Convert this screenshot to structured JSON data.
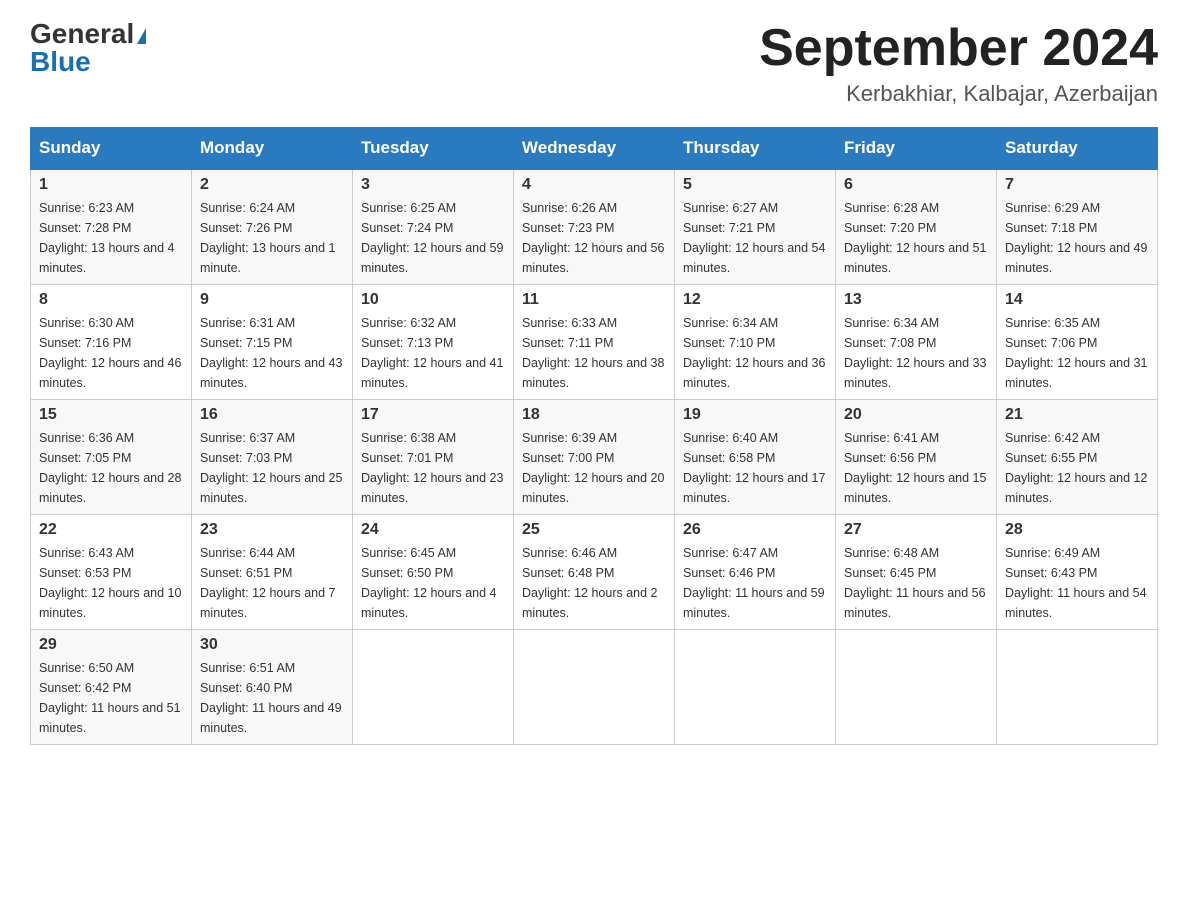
{
  "logo": {
    "general": "General",
    "blue": "Blue"
  },
  "title": {
    "month_year": "September 2024",
    "location": "Kerbakhiar, Kalbajar, Azerbaijan"
  },
  "headers": [
    "Sunday",
    "Monday",
    "Tuesday",
    "Wednesday",
    "Thursday",
    "Friday",
    "Saturday"
  ],
  "weeks": [
    [
      {
        "day": "1",
        "sunrise": "Sunrise: 6:23 AM",
        "sunset": "Sunset: 7:28 PM",
        "daylight": "Daylight: 13 hours and 4 minutes."
      },
      {
        "day": "2",
        "sunrise": "Sunrise: 6:24 AM",
        "sunset": "Sunset: 7:26 PM",
        "daylight": "Daylight: 13 hours and 1 minute."
      },
      {
        "day": "3",
        "sunrise": "Sunrise: 6:25 AM",
        "sunset": "Sunset: 7:24 PM",
        "daylight": "Daylight: 12 hours and 59 minutes."
      },
      {
        "day": "4",
        "sunrise": "Sunrise: 6:26 AM",
        "sunset": "Sunset: 7:23 PM",
        "daylight": "Daylight: 12 hours and 56 minutes."
      },
      {
        "day": "5",
        "sunrise": "Sunrise: 6:27 AM",
        "sunset": "Sunset: 7:21 PM",
        "daylight": "Daylight: 12 hours and 54 minutes."
      },
      {
        "day": "6",
        "sunrise": "Sunrise: 6:28 AM",
        "sunset": "Sunset: 7:20 PM",
        "daylight": "Daylight: 12 hours and 51 minutes."
      },
      {
        "day": "7",
        "sunrise": "Sunrise: 6:29 AM",
        "sunset": "Sunset: 7:18 PM",
        "daylight": "Daylight: 12 hours and 49 minutes."
      }
    ],
    [
      {
        "day": "8",
        "sunrise": "Sunrise: 6:30 AM",
        "sunset": "Sunset: 7:16 PM",
        "daylight": "Daylight: 12 hours and 46 minutes."
      },
      {
        "day": "9",
        "sunrise": "Sunrise: 6:31 AM",
        "sunset": "Sunset: 7:15 PM",
        "daylight": "Daylight: 12 hours and 43 minutes."
      },
      {
        "day": "10",
        "sunrise": "Sunrise: 6:32 AM",
        "sunset": "Sunset: 7:13 PM",
        "daylight": "Daylight: 12 hours and 41 minutes."
      },
      {
        "day": "11",
        "sunrise": "Sunrise: 6:33 AM",
        "sunset": "Sunset: 7:11 PM",
        "daylight": "Daylight: 12 hours and 38 minutes."
      },
      {
        "day": "12",
        "sunrise": "Sunrise: 6:34 AM",
        "sunset": "Sunset: 7:10 PM",
        "daylight": "Daylight: 12 hours and 36 minutes."
      },
      {
        "day": "13",
        "sunrise": "Sunrise: 6:34 AM",
        "sunset": "Sunset: 7:08 PM",
        "daylight": "Daylight: 12 hours and 33 minutes."
      },
      {
        "day": "14",
        "sunrise": "Sunrise: 6:35 AM",
        "sunset": "Sunset: 7:06 PM",
        "daylight": "Daylight: 12 hours and 31 minutes."
      }
    ],
    [
      {
        "day": "15",
        "sunrise": "Sunrise: 6:36 AM",
        "sunset": "Sunset: 7:05 PM",
        "daylight": "Daylight: 12 hours and 28 minutes."
      },
      {
        "day": "16",
        "sunrise": "Sunrise: 6:37 AM",
        "sunset": "Sunset: 7:03 PM",
        "daylight": "Daylight: 12 hours and 25 minutes."
      },
      {
        "day": "17",
        "sunrise": "Sunrise: 6:38 AM",
        "sunset": "Sunset: 7:01 PM",
        "daylight": "Daylight: 12 hours and 23 minutes."
      },
      {
        "day": "18",
        "sunrise": "Sunrise: 6:39 AM",
        "sunset": "Sunset: 7:00 PM",
        "daylight": "Daylight: 12 hours and 20 minutes."
      },
      {
        "day": "19",
        "sunrise": "Sunrise: 6:40 AM",
        "sunset": "Sunset: 6:58 PM",
        "daylight": "Daylight: 12 hours and 17 minutes."
      },
      {
        "day": "20",
        "sunrise": "Sunrise: 6:41 AM",
        "sunset": "Sunset: 6:56 PM",
        "daylight": "Daylight: 12 hours and 15 minutes."
      },
      {
        "day": "21",
        "sunrise": "Sunrise: 6:42 AM",
        "sunset": "Sunset: 6:55 PM",
        "daylight": "Daylight: 12 hours and 12 minutes."
      }
    ],
    [
      {
        "day": "22",
        "sunrise": "Sunrise: 6:43 AM",
        "sunset": "Sunset: 6:53 PM",
        "daylight": "Daylight: 12 hours and 10 minutes."
      },
      {
        "day": "23",
        "sunrise": "Sunrise: 6:44 AM",
        "sunset": "Sunset: 6:51 PM",
        "daylight": "Daylight: 12 hours and 7 minutes."
      },
      {
        "day": "24",
        "sunrise": "Sunrise: 6:45 AM",
        "sunset": "Sunset: 6:50 PM",
        "daylight": "Daylight: 12 hours and 4 minutes."
      },
      {
        "day": "25",
        "sunrise": "Sunrise: 6:46 AM",
        "sunset": "Sunset: 6:48 PM",
        "daylight": "Daylight: 12 hours and 2 minutes."
      },
      {
        "day": "26",
        "sunrise": "Sunrise: 6:47 AM",
        "sunset": "Sunset: 6:46 PM",
        "daylight": "Daylight: 11 hours and 59 minutes."
      },
      {
        "day": "27",
        "sunrise": "Sunrise: 6:48 AM",
        "sunset": "Sunset: 6:45 PM",
        "daylight": "Daylight: 11 hours and 56 minutes."
      },
      {
        "day": "28",
        "sunrise": "Sunrise: 6:49 AM",
        "sunset": "Sunset: 6:43 PM",
        "daylight": "Daylight: 11 hours and 54 minutes."
      }
    ],
    [
      {
        "day": "29",
        "sunrise": "Sunrise: 6:50 AM",
        "sunset": "Sunset: 6:42 PM",
        "daylight": "Daylight: 11 hours and 51 minutes."
      },
      {
        "day": "30",
        "sunrise": "Sunrise: 6:51 AM",
        "sunset": "Sunset: 6:40 PM",
        "daylight": "Daylight: 11 hours and 49 minutes."
      },
      {
        "day": "",
        "sunrise": "",
        "sunset": "",
        "daylight": ""
      },
      {
        "day": "",
        "sunrise": "",
        "sunset": "",
        "daylight": ""
      },
      {
        "day": "",
        "sunrise": "",
        "sunset": "",
        "daylight": ""
      },
      {
        "day": "",
        "sunrise": "",
        "sunset": "",
        "daylight": ""
      },
      {
        "day": "",
        "sunrise": "",
        "sunset": "",
        "daylight": ""
      }
    ]
  ]
}
